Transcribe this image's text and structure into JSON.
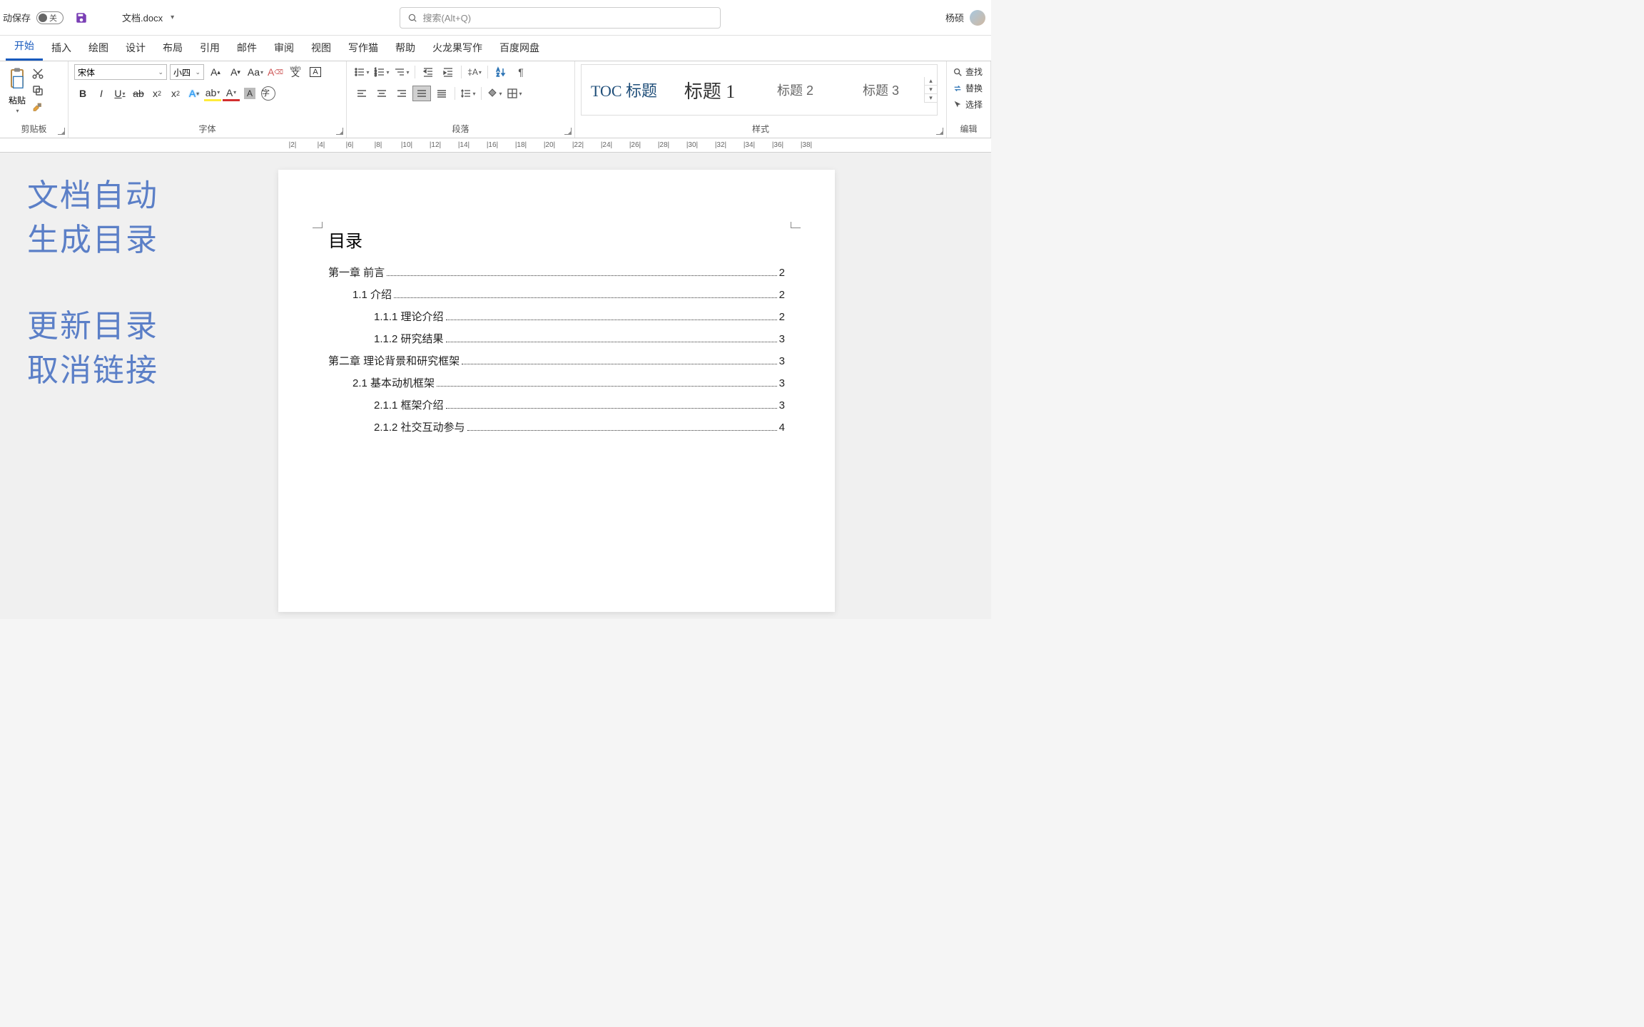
{
  "titlebar": {
    "autosave_label": "动保存",
    "toggle_off": "关",
    "filename": "文档.docx",
    "search_placeholder": "搜索(Alt+Q)",
    "username": "杨硕"
  },
  "tabs": [
    "开始",
    "插入",
    "绘图",
    "设计",
    "布局",
    "引用",
    "邮件",
    "审阅",
    "视图",
    "写作猫",
    "帮助",
    "火龙果写作",
    "百度网盘"
  ],
  "active_tab": 0,
  "ribbon": {
    "clipboard": {
      "paste": "粘贴",
      "label": "剪贴板"
    },
    "font": {
      "name": "宋体",
      "size": "小四",
      "label": "字体",
      "wen": "wén",
      "char_box": "A"
    },
    "paragraph": {
      "label": "段落"
    },
    "styles": {
      "label": "样式",
      "items": [
        "TOC 标题",
        "标题 1",
        "标题 2",
        "标题 3"
      ]
    },
    "editing": {
      "label": "编辑",
      "find": "查找",
      "replace": "替换",
      "select": "选择"
    }
  },
  "ruler_numbers": [
    "2",
    "4",
    "6",
    "8",
    "10",
    "12",
    "14",
    "16",
    "18",
    "20",
    "22",
    "24",
    "26",
    "28",
    "30",
    "32",
    "34",
    "36",
    "38"
  ],
  "side_annotations": {
    "line1": "文档自动",
    "line2": "生成目录",
    "line3": "更新目录",
    "line4": "取消链接"
  },
  "document": {
    "toc_title": "目录",
    "entries": [
      {
        "level": 1,
        "text": "第一章  前言",
        "page": "2"
      },
      {
        "level": 2,
        "text": "1.1 介绍",
        "page": "2"
      },
      {
        "level": 3,
        "text": "1.1.1  理论介绍",
        "page": "2"
      },
      {
        "level": 3,
        "text": "1.1.2 研究结果",
        "page": "3"
      },
      {
        "level": 1,
        "text": "第二章  理论背景和研究框架",
        "page": "3"
      },
      {
        "level": 2,
        "text": "2.1 基本动机框架",
        "page": "3"
      },
      {
        "level": 3,
        "text": "2.1.1  框架介绍",
        "page": "3"
      },
      {
        "level": 3,
        "text": "2.1.2 社交互动参与",
        "page": "4"
      }
    ]
  }
}
